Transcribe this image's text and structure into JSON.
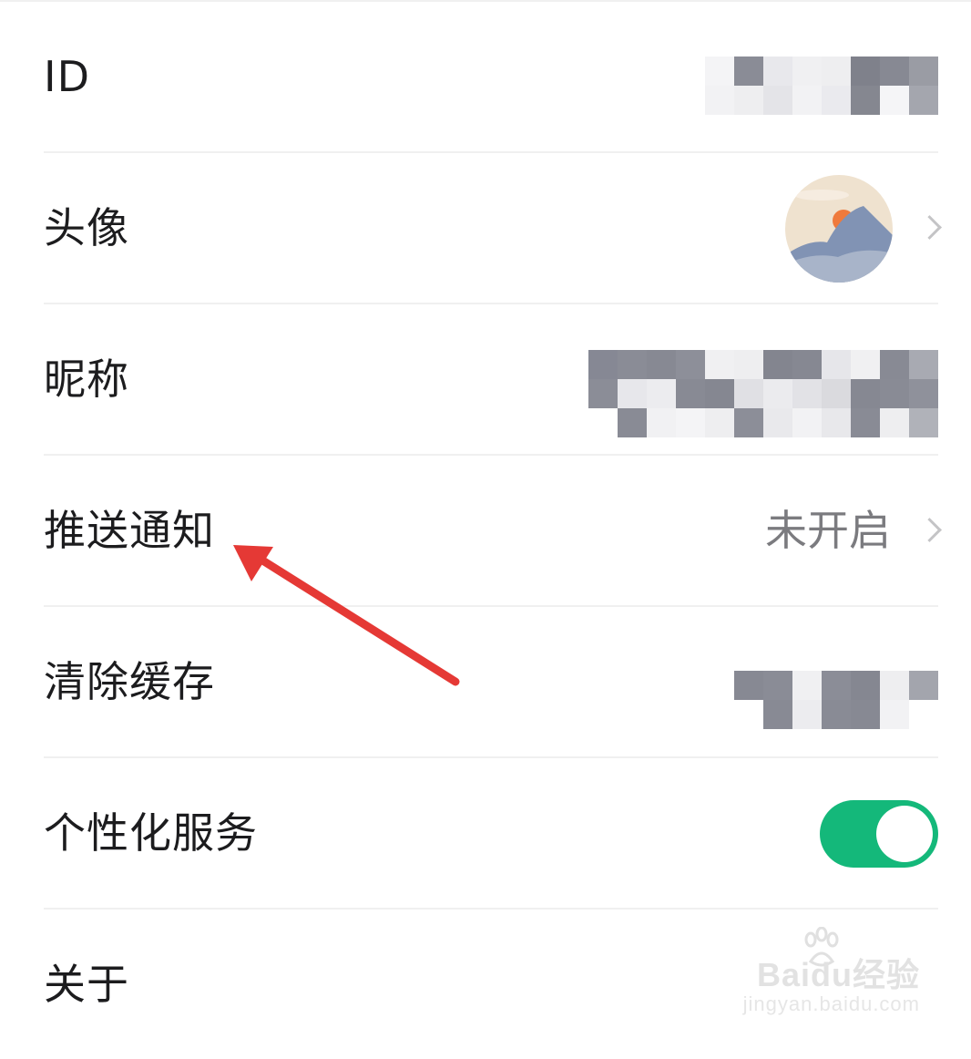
{
  "settings": {
    "rows": {
      "id": {
        "label": "ID"
      },
      "avatar": {
        "label": "头像"
      },
      "nickname": {
        "label": "昵称"
      },
      "push": {
        "label": "推送通知",
        "value": "未开启"
      },
      "cache": {
        "label": "清除缓存"
      },
      "personalized": {
        "label": "个性化服务",
        "toggle_on": true
      },
      "about": {
        "label": "关于"
      }
    }
  },
  "annotation": {
    "arrow_color": "#e53935"
  },
  "watermark": {
    "brand": "Baidu经验",
    "url": "jingyan.baidu.com"
  },
  "colors": {
    "accent_green": "#14b87a",
    "text_primary": "#1c1c1e",
    "text_secondary": "#7b7b7f",
    "divider": "#f0f0f0"
  },
  "icons": {
    "chevron": "chevron-right-icon",
    "avatar": "mountain-sun-avatar",
    "watermark": "baidu-paw-icon"
  }
}
